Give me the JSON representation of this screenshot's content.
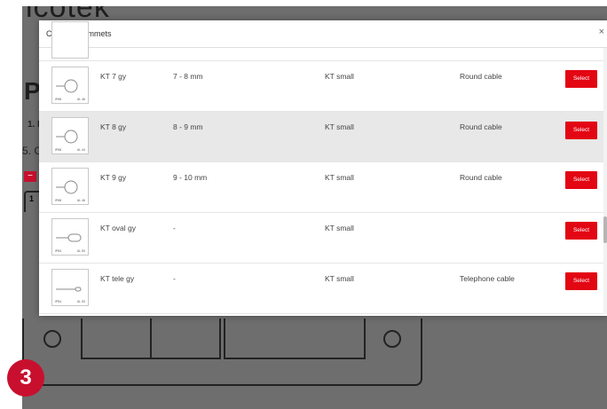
{
  "background": {
    "logo_text": "icotek",
    "page_heading_letter": "P",
    "step_1_label": "1. F",
    "step_5_label": "5. C",
    "minus_label": "−",
    "tab_label": "1",
    "step_badge": "3"
  },
  "dialog": {
    "title": "Choose grommets",
    "close_glyph": "×",
    "select_label": "Select",
    "rows": [
      {
        "name": "KT 7 gy",
        "range": "7 - 8 mm",
        "type": "KT small",
        "usage": "Round cable",
        "thumb_shape": "round-hole",
        "thumb_code_left": "IP68",
        "thumb_code_right": "UL 46",
        "highlighted": false
      },
      {
        "name": "KT 8 gy",
        "range": "8 - 9 mm",
        "type": "KT small",
        "usage": "Round cable",
        "thumb_shape": "round-hole",
        "thumb_code_left": "IP68",
        "thumb_code_right": "UL 44",
        "highlighted": true
      },
      {
        "name": "KT 9 gy",
        "range": "9 - 10 mm",
        "type": "KT small",
        "usage": "Round cable",
        "thumb_shape": "round-hole",
        "thumb_code_left": "IP68",
        "thumb_code_right": "UL 46",
        "highlighted": false
      },
      {
        "name": "KT oval gy",
        "range": "-",
        "type": "KT small",
        "usage": "",
        "thumb_shape": "oval-slot",
        "thumb_code_left": "IP54",
        "thumb_code_right": "UL 53",
        "highlighted": false
      },
      {
        "name": "KT tele gy",
        "range": "-",
        "type": "KT small",
        "usage": "Telephone cable",
        "thumb_shape": "tele-slot",
        "thumb_code_left": "IP54",
        "thumb_code_right": "UL 53",
        "highlighted": false
      }
    ]
  },
  "colors": {
    "select_button": "#e30613",
    "badge": "#c8102e",
    "overlay": "#6e6e6e",
    "row_highlight": "#e8e8e8"
  }
}
